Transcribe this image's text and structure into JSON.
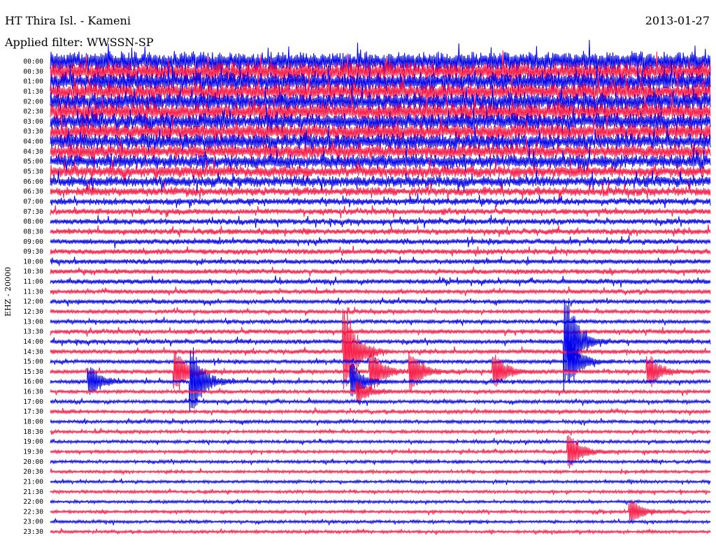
{
  "header": {
    "station": "HT Thira Isl. - Kameni",
    "date": "2013-01-27",
    "filter_label": "Applied filter: WWSSN-SP"
  },
  "chart_data": {
    "type": "line",
    "title": "HT Thira Isl. - Kameni",
    "subtitle": "Applied filter: WWSSN-SP",
    "date": "2013-01-27",
    "ylabel": "EHZ - 20000",
    "trace_interval_minutes": 30,
    "trace_duration_minutes": 30,
    "row_labels": [
      "00:00",
      "00:30",
      "01:00",
      "01:30",
      "02:00",
      "02:30",
      "03:00",
      "03:30",
      "04:00",
      "04:30",
      "05:00",
      "05:30",
      "06:00",
      "06:30",
      "07:00",
      "07:30",
      "08:00",
      "08:30",
      "09:00",
      "09:30",
      "10:00",
      "10:30",
      "11:00",
      "11:30",
      "12:00",
      "12:30",
      "13:00",
      "13:30",
      "14:00",
      "14:30",
      "15:00",
      "15:30",
      "16:00",
      "16:30",
      "17:00",
      "17:30",
      "18:00",
      "18:30",
      "19:00",
      "19:30",
      "20:00",
      "20:30",
      "21:00",
      "21:30",
      "22:00",
      "22:30",
      "23:00",
      "23:30"
    ],
    "row_amplitude": [
      1.0,
      0.95,
      0.95,
      0.9,
      0.9,
      0.9,
      0.85,
      0.85,
      0.8,
      0.75,
      0.7,
      0.6,
      0.55,
      0.45,
      0.35,
      0.3,
      0.3,
      0.3,
      0.28,
      0.28,
      0.25,
      0.25,
      0.25,
      0.22,
      0.22,
      0.2,
      0.2,
      0.22,
      0.22,
      0.22,
      0.2,
      0.2,
      0.2,
      0.18,
      0.18,
      0.18,
      0.18,
      0.16,
      0.16,
      0.16,
      0.16,
      0.15,
      0.15,
      0.15,
      0.15,
      0.15,
      0.15,
      0.15
    ],
    "series_colors": [
      "#0000ee",
      "#ff1744"
    ],
    "grid": false,
    "legend": "none",
    "events": [
      {
        "row": 29,
        "minute": 13.5,
        "amplitude": 3.5
      },
      {
        "row": 28,
        "minute": 23.5,
        "amplitude": 4.0
      },
      {
        "row": 30,
        "minute": 23.7,
        "amplitude": 2.0
      },
      {
        "row": 31,
        "minute": 5.8,
        "amplitude": 1.8
      },
      {
        "row": 31,
        "minute": 14.7,
        "amplitude": 1.8
      },
      {
        "row": 31,
        "minute": 16.5,
        "amplitude": 1.6
      },
      {
        "row": 31,
        "minute": 20.3,
        "amplitude": 1.5
      },
      {
        "row": 31,
        "minute": 27.3,
        "amplitude": 1.3
      },
      {
        "row": 32,
        "minute": 6.5,
        "amplitude": 3.0
      },
      {
        "row": 32,
        "minute": 1.9,
        "amplitude": 1.2
      },
      {
        "row": 32,
        "minute": 13.8,
        "amplitude": 1.5
      },
      {
        "row": 33,
        "minute": 14.1,
        "amplitude": 1.0
      },
      {
        "row": 39,
        "minute": 23.7,
        "amplitude": 1.8
      },
      {
        "row": 45,
        "minute": 26.5,
        "amplitude": 1.2
      }
    ]
  }
}
